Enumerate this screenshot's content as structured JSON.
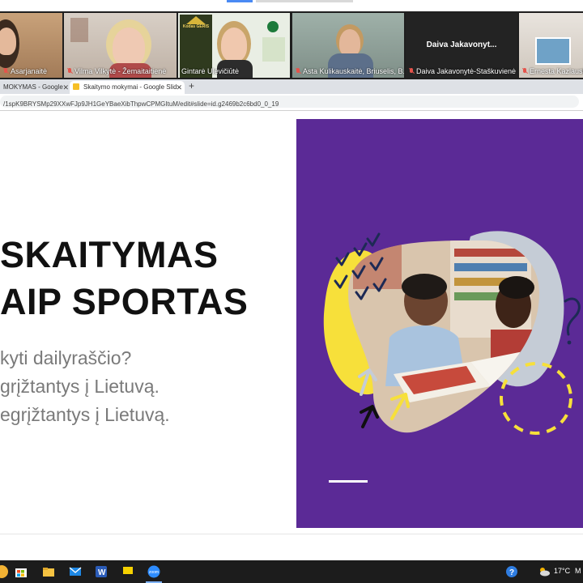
{
  "zoom": {
    "participants": [
      {
        "name": "Asarjanaitė"
      },
      {
        "name": "Vilma Vilkytė - Žemaitaitienė"
      },
      {
        "name": "Gintarė Ulevičiūtė",
        "backdrop_text": "Kodas GĖRIS"
      },
      {
        "name": "Asta Kulikauskaitė, Briuselis, B..."
      },
      {
        "name": "Daiva Jakavonytė-Staškuvienė",
        "display_name": "Daiva  Jakavonyt..."
      },
      {
        "name": "Ernesta Kazlausk"
      }
    ]
  },
  "browser": {
    "tabs": [
      {
        "label": "MOKYMAS - Google"
      },
      {
        "label": "Skaitymo mokymai - Google Slid"
      }
    ],
    "new_tab": "+",
    "url": "/1spK9BRYSMp29XXwFJp9JH1GeYBaeXibThpwCPMGItuM/edit#slide=id.g2469b2c6bd0_0_19"
  },
  "slide": {
    "title_lines": [
      "SKAITYMAS",
      "AIP SPORTAS"
    ],
    "subtitle_lines": [
      "kyti dailyraščio?",
      "grįžtantys į Lietuvą.",
      "egrįžtantys į Lietuvą."
    ],
    "colors": {
      "purple": "#5b2a96",
      "yellow": "#f7e03a",
      "grey": "#c5ccd6"
    }
  },
  "taskbar": {
    "weather": "17°C",
    "tray_letter": "M",
    "zoom_label": "zoom"
  }
}
